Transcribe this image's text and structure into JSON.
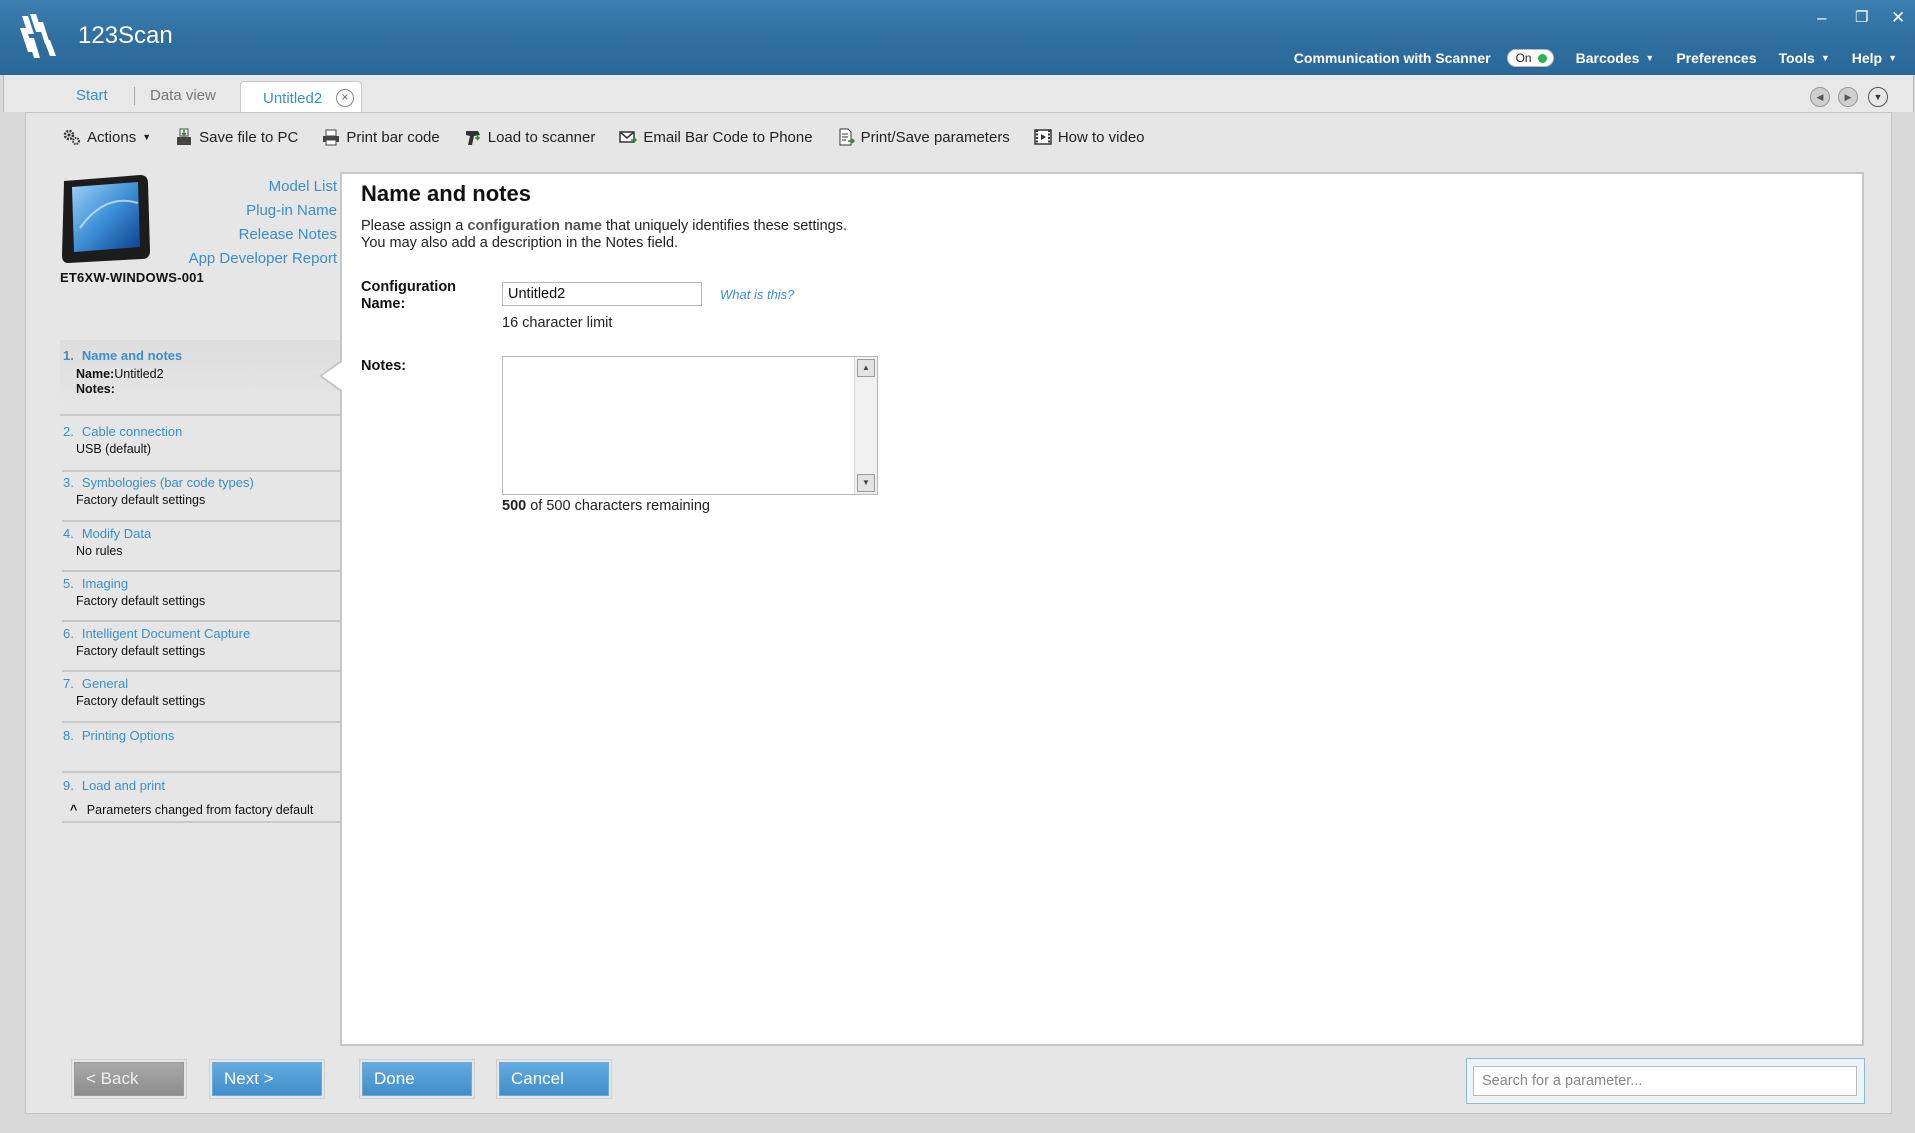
{
  "app": {
    "title": "123Scan"
  },
  "window_controls": {
    "minimize": "–",
    "restore": "❐",
    "close": "✕"
  },
  "menu": {
    "communication_label": "Communication with Scanner",
    "communication_toggle": "On",
    "items": [
      "Barcodes",
      "Preferences",
      "Tools",
      "Help"
    ]
  },
  "tabs": {
    "start": "Start",
    "data_view": "Data view",
    "active": "Untitled2"
  },
  "toolbar": {
    "actions": "Actions",
    "save": "Save file to PC",
    "print": "Print bar code",
    "load": "Load to scanner",
    "email": "Email Bar Code to Phone",
    "print_save": "Print/Save parameters",
    "video": "How to video"
  },
  "device": {
    "name": "ET6XW-WINDOWS-001",
    "links": [
      "Model List",
      "Plug-in Name",
      "Release Notes",
      "App Developer Report"
    ]
  },
  "steps": [
    {
      "num": "1.",
      "title": "Name and notes",
      "name_label": "Name:",
      "name_value": "Untitled2",
      "notes_label": "Notes:"
    },
    {
      "num": "2.",
      "title": "Cable connection",
      "sub": "USB (default)"
    },
    {
      "num": "3.",
      "title": "Symbologies (bar code types)",
      "sub": "Factory default settings"
    },
    {
      "num": "4.",
      "title": "Modify Data",
      "sub": "No rules"
    },
    {
      "num": "5.",
      "title": "Imaging",
      "sub": "Factory default settings"
    },
    {
      "num": "6.",
      "title": "Intelligent Document Capture",
      "sub": "Factory default settings"
    },
    {
      "num": "7.",
      "title": "General",
      "sub": "Factory default settings"
    },
    {
      "num": "8.",
      "title": "Printing Options",
      "sub": ""
    },
    {
      "num": "9.",
      "title": "Load and print",
      "sub": ""
    }
  ],
  "legend": {
    "mark": "^",
    "text": "Parameters changed from factory default"
  },
  "content": {
    "title": "Name and notes",
    "desc_1a": "Please assign a ",
    "desc_1b": "configuration name",
    "desc_1c": " that uniquely identifies these settings.",
    "desc_2": "You may also add a description in the Notes field.",
    "config_label_1": "Configuration",
    "config_label_2": "Name:",
    "config_value": "Untitled2",
    "what_is_this": "What is this?",
    "limit": "16 character limit",
    "notes_label": "Notes:",
    "notes_value": "",
    "remaining_count": "500",
    "remaining_text": " of 500 characters remaining"
  },
  "buttons": {
    "back": "< Back",
    "next": "Next >",
    "done": "Done",
    "cancel": "Cancel"
  },
  "search": {
    "placeholder": "Search for a parameter..."
  },
  "colors": {
    "titlebar": "#2f6e9f",
    "link": "#3a8fcb",
    "button": "#4d9ad4",
    "toggle_on": "#2bb34a"
  }
}
